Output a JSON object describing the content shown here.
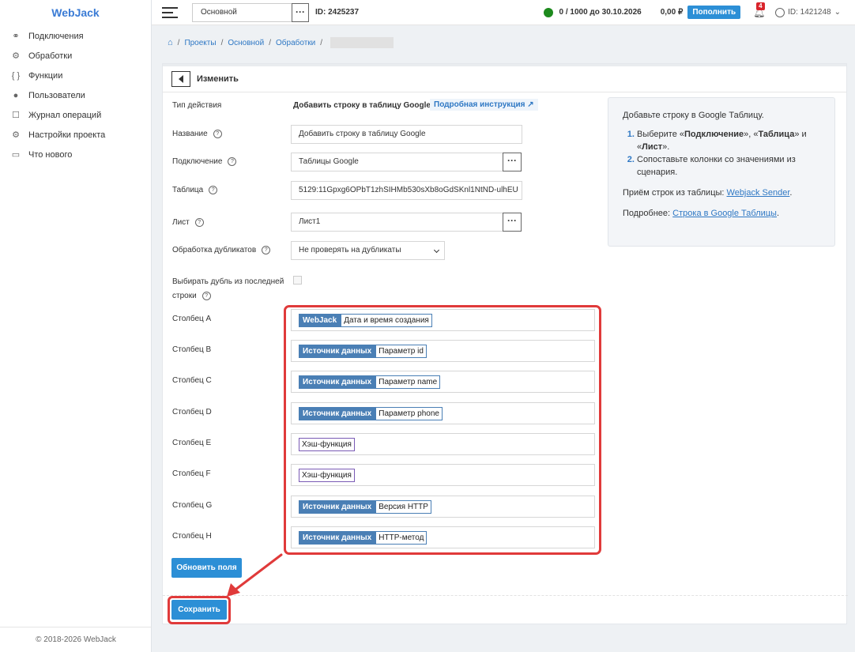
{
  "sidebar": {
    "logo": "WebJack",
    "items": [
      {
        "label": "Подключения",
        "icon": "link-icon"
      },
      {
        "label": "Обработки",
        "icon": "gear-icon"
      },
      {
        "label": "Функции",
        "icon": "braces-icon"
      },
      {
        "label": "Пользователи",
        "icon": "user-icon"
      },
      {
        "label": "Журнал операций",
        "icon": "document-icon"
      },
      {
        "label": "Настройки проекта",
        "icon": "gear-icon"
      },
      {
        "label": "Что нового",
        "icon": "calendar-icon"
      }
    ],
    "footer": "© 2018-2026 WebJack"
  },
  "header": {
    "project": "Основной",
    "project_id": "ID: 2425237",
    "quota": "0 / 1000 до 30.10.2026",
    "balance": "0,00 ₽",
    "topup_label": "Пополнить",
    "notifications": "4",
    "user_id": "ID: 1421248"
  },
  "breadcrumb": [
    "Проекты",
    "Основной",
    "Обработки"
  ],
  "card": {
    "title": "Изменить",
    "action_type_label": "Тип действия",
    "action_type_value": "Добавить строку в таблицу Google",
    "doc_link": "Подробная инструкция ↗",
    "name_label": "Название",
    "name_value": "Добавить строку в таблицу Google",
    "connection_label": "Подключение",
    "connection_value": "Таблицы Google",
    "table_label": "Таблица",
    "table_value": "5129:11Gpxg6OPbT1zhSIHMb530sXb8oGdSKnl1NtND-ulhEU",
    "sheet_label": "Лист",
    "sheet_value": "Лист1",
    "dup_label": "Обработка дубликатов",
    "dup_value": "Не проверять на дубликаты",
    "last_row_label_1": "Выбирать дубль из последней",
    "last_row_label_2": "строки",
    "columns": [
      {
        "label": "Столбец A",
        "source": "WebJack",
        "value": "Дата и время создания"
      },
      {
        "label": "Столбец B",
        "source": "Источник данных",
        "value": "Параметр id"
      },
      {
        "label": "Столбец C",
        "source": "Источник данных",
        "value": "Параметр name"
      },
      {
        "label": "Столбец D",
        "source": "Источник данных",
        "value": "Параметр phone"
      },
      {
        "label": "Столбец E",
        "source": "",
        "value": "Хэш-функция"
      },
      {
        "label": "Столбец F",
        "source": "",
        "value": "Хэш-функция"
      },
      {
        "label": "Столбец G",
        "source": "Источник данных",
        "value": "Версия HTTP"
      },
      {
        "label": "Столбец H",
        "source": "Источник данных",
        "value": "HTTP-метод"
      }
    ],
    "refresh_label": "Обновить поля",
    "save_label": "Сохранить"
  },
  "info": {
    "intro": "Добавьте строку в Google Таблицу.",
    "step1_a": "Выберите «",
    "step1_b": "Подключение",
    "step1_c": "», «",
    "step1_d": "Таблица",
    "step1_e": "» и «",
    "step1_f": "Лист",
    "step1_g": "».",
    "step2": "Сопоставьте колонки со значениями из сценария.",
    "receive_prefix": "Приём строк из таблицы: ",
    "receive_link": "Webjack Sender",
    "receive_suffix": ".",
    "more_prefix": "Подробнее: ",
    "more_link": "Строка в Google Таблицы",
    "more_suffix": "."
  },
  "colors": {
    "accent": "#2c8fd6",
    "highlight": "#e03a3a",
    "tag": "#4a7fb5"
  }
}
